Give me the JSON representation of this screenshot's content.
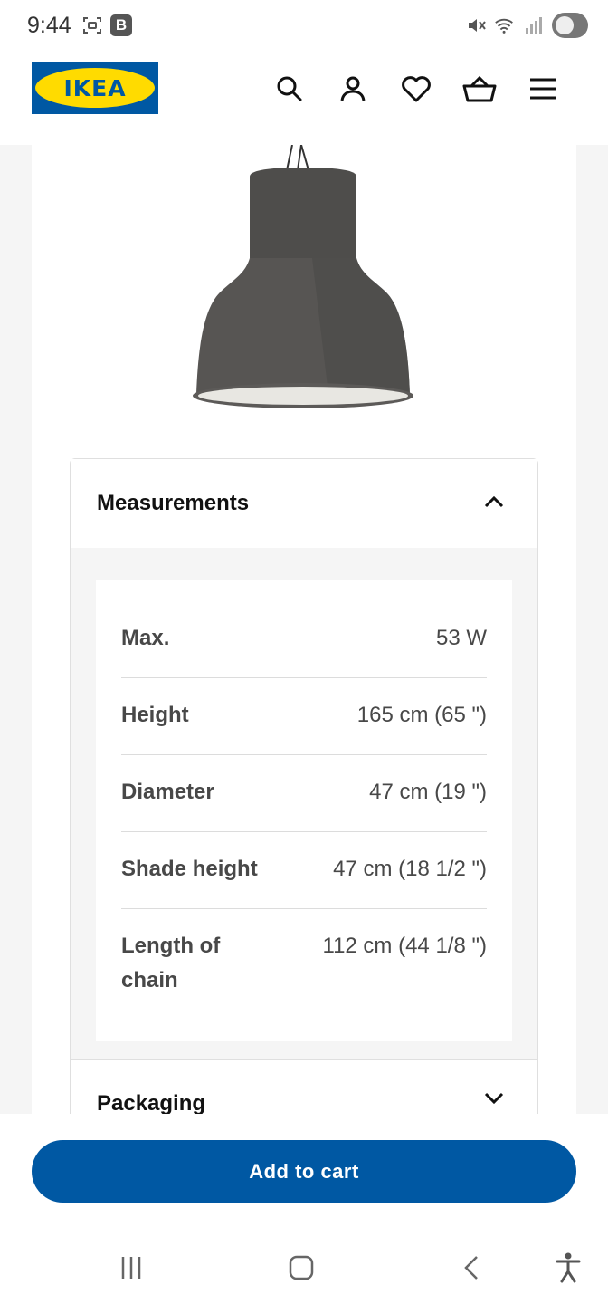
{
  "status_bar": {
    "time": "9:44",
    "badge": "B"
  },
  "header": {
    "logo_text": "IKEA",
    "icons": [
      "search-icon",
      "account-icon",
      "heart-icon",
      "basket-icon",
      "menu-icon"
    ]
  },
  "measurements": {
    "title": "Measurements",
    "rows": [
      {
        "label": "Max.",
        "value": "53 W"
      },
      {
        "label": "Height",
        "value": "165 cm (65 \")"
      },
      {
        "label": "Diameter",
        "value": "47 cm (19 \")"
      },
      {
        "label": "Shade height",
        "value": "47 cm (18 1/2 \")"
      },
      {
        "label": "Length of chain",
        "value": "112 cm (44 1/8 \")"
      }
    ]
  },
  "packaging": {
    "title": "Packaging"
  },
  "cart": {
    "label": "Add to cart"
  },
  "colors": {
    "brand_blue": "#0058a3",
    "brand_yellow": "#ffdb00"
  }
}
